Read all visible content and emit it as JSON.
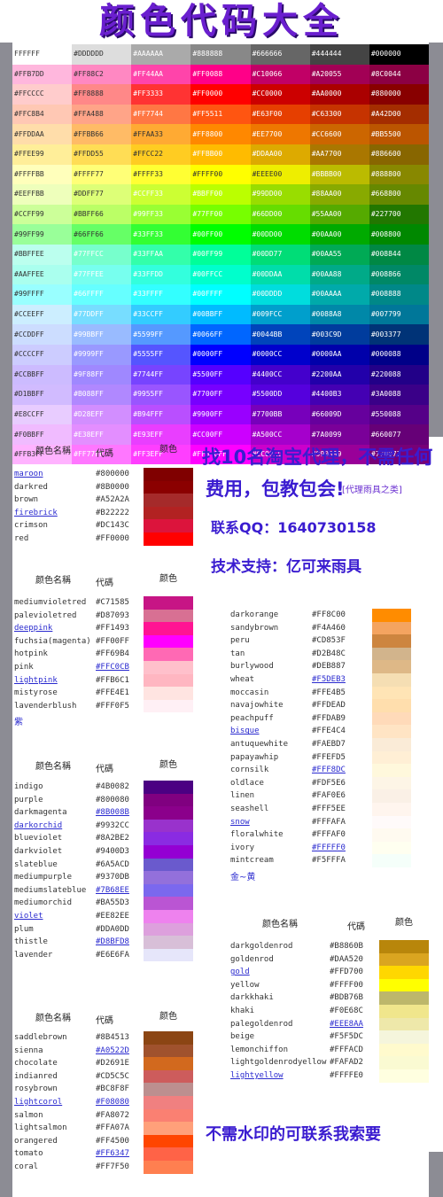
{
  "title": "颜色代码大全",
  "grid": [
    [
      [
        "FFFFFF",
        "#FFFFFF",
        "#333"
      ],
      [
        "#DDDDDD",
        "#DDDDDD",
        "#333"
      ],
      [
        "#AAAAAA",
        "#AAAAAA",
        "#fff"
      ],
      [
        "#888888",
        "#888888",
        "#fff"
      ],
      [
        "#666666",
        "#666666",
        "#fff"
      ],
      [
        "#444444",
        "#444444",
        "#fff"
      ],
      [
        "#000000",
        "#000000",
        "#fff"
      ]
    ],
    [
      [
        "#FFB7DD",
        "#FFB7DD",
        "#333"
      ],
      [
        "#FF88C2",
        "#FF88C2",
        "#333"
      ],
      [
        "#FF44AA",
        "#FF44AA",
        "#fff"
      ],
      [
        "#FF0088",
        "#FF0088",
        "#fff"
      ],
      [
        "#C10066",
        "#C10066",
        "#fff"
      ],
      [
        "#A20055",
        "#A20055",
        "#fff"
      ],
      [
        "#8C0044",
        "#8C0044",
        "#fff"
      ]
    ],
    [
      [
        "#FFCCCC",
        "#FFCCCC",
        "#333"
      ],
      [
        "#FF8888",
        "#FF8888",
        "#333"
      ],
      [
        "#FF3333",
        "#FF3333",
        "#fff"
      ],
      [
        "#FF0000",
        "#FF0000",
        "#fff"
      ],
      [
        "#CC0000",
        "#CC0000",
        "#fff"
      ],
      [
        "#AA0000",
        "#AA0000",
        "#fff"
      ],
      [
        "#880000",
        "#880000",
        "#fff"
      ]
    ],
    [
      [
        "#FFC8B4",
        "#FFC8B4",
        "#333"
      ],
      [
        "#FFA488",
        "#FFA488",
        "#333"
      ],
      [
        "#FF7744",
        "#FF7744",
        "#fff"
      ],
      [
        "#FF5511",
        "#FF5511",
        "#fff"
      ],
      [
        "#E63F00",
        "#E63F00",
        "#fff"
      ],
      [
        "#C63300",
        "#C63300",
        "#fff"
      ],
      [
        "#A42D00",
        "#A42D00",
        "#fff"
      ]
    ],
    [
      [
        "#FFDDAA",
        "#FFDDAA",
        "#333"
      ],
      [
        "#FFBB66",
        "#FFBB66",
        "#333"
      ],
      [
        "#FFAA33",
        "#FFAA33",
        "#333"
      ],
      [
        "#FF8800",
        "#FF8800",
        "#fff"
      ],
      [
        "#EE7700",
        "#EE7700",
        "#fff"
      ],
      [
        "#CC6600",
        "#CC6600",
        "#fff"
      ],
      [
        "#BB5500",
        "#BB5500",
        "#fff"
      ]
    ],
    [
      [
        "#FFEE99",
        "#FFEE99",
        "#333"
      ],
      [
        "#FFDD55",
        "#FFDD55",
        "#333"
      ],
      [
        "#FFCC22",
        "#FFCC22",
        "#333"
      ],
      [
        "#FFBB00",
        "#FFBB00",
        "#fff"
      ],
      [
        "#DDAA00",
        "#DDAA00",
        "#fff"
      ],
      [
        "#AA7700",
        "#AA7700",
        "#fff"
      ],
      [
        "#886600",
        "#886600",
        "#fff"
      ]
    ],
    [
      [
        "#FFFFBB",
        "#FFFFBB",
        "#333"
      ],
      [
        "#FFFF77",
        "#FFFF77",
        "#333"
      ],
      [
        "#FFFF33",
        "#FFFF33",
        "#333"
      ],
      [
        "#FFFF00",
        "#FFFF00",
        "#333"
      ],
      [
        "#EEEE00",
        "#EEEE00",
        "#333"
      ],
      [
        "#BBBB00",
        "#BBBB00",
        "#fff"
      ],
      [
        "#888800",
        "#888800",
        "#fff"
      ]
    ],
    [
      [
        "#EEFFBB",
        "#EEFFBB",
        "#333"
      ],
      [
        "#DDFF77",
        "#DDFF77",
        "#333"
      ],
      [
        "#CCFF33",
        "#CCFF33",
        "#fff"
      ],
      [
        "#BBFF00",
        "#BBFF00",
        "#fff"
      ],
      [
        "#99DD00",
        "#99DD00",
        "#fff"
      ],
      [
        "#88AA00",
        "#88AA00",
        "#fff"
      ],
      [
        "#668800",
        "#668800",
        "#fff"
      ]
    ],
    [
      [
        "#CCFF99",
        "#CCFF99",
        "#333"
      ],
      [
        "#BBFF66",
        "#BBFF66",
        "#333"
      ],
      [
        "#99FF33",
        "#99FF33",
        "#fff"
      ],
      [
        "#77FF00",
        "#77FF00",
        "#fff"
      ],
      [
        "#66DD00",
        "#66DD00",
        "#fff"
      ],
      [
        "#55AA00",
        "#55AA00",
        "#fff"
      ],
      [
        "#227700",
        "#227700",
        "#fff"
      ]
    ],
    [
      [
        "#99FF99",
        "#99FF99",
        "#333"
      ],
      [
        "#66FF66",
        "#66FF66",
        "#333"
      ],
      [
        "#33FF33",
        "#33FF33",
        "#fff"
      ],
      [
        "#00FF00",
        "#00FF00",
        "#fff"
      ],
      [
        "#00DD00",
        "#00DD00",
        "#fff"
      ],
      [
        "#00AA00",
        "#00AA00",
        "#fff"
      ],
      [
        "#008800",
        "#008800",
        "#fff"
      ]
    ],
    [
      [
        "#BBFFEE",
        "#BBFFEE",
        "#333"
      ],
      [
        "#77FFCC",
        "#77FFCC",
        "#fff"
      ],
      [
        "#33FFAA",
        "#33FFAA",
        "#fff"
      ],
      [
        "#00FF99",
        "#00FF99",
        "#fff"
      ],
      [
        "#00DD77",
        "#00DD77",
        "#fff"
      ],
      [
        "#00AA55",
        "#00AA55",
        "#fff"
      ],
      [
        "#008844",
        "#008844",
        "#fff"
      ]
    ],
    [
      [
        "#AAFFEE",
        "#AAFFEE",
        "#333"
      ],
      [
        "#77FFEE",
        "#77FFEE",
        "#fff"
      ],
      [
        "#33FFDD",
        "#33FFDD",
        "#fff"
      ],
      [
        "#00FFCC",
        "#00FFCC",
        "#fff"
      ],
      [
        "#00DDAA",
        "#00DDAA",
        "#fff"
      ],
      [
        "#00AA88",
        "#00AA88",
        "#fff"
      ],
      [
        "#008866",
        "#008866",
        "#fff"
      ]
    ],
    [
      [
        "#99FFFF",
        "#99FFFF",
        "#333"
      ],
      [
        "#66FFFF",
        "#66FFFF",
        "#fff"
      ],
      [
        "#33FFFF",
        "#33FFFF",
        "#fff"
      ],
      [
        "#00FFFF",
        "#00FFFF",
        "#fff"
      ],
      [
        "#00DDDD",
        "#00DDDD",
        "#fff"
      ],
      [
        "#00AAAA",
        "#00AAAA",
        "#fff"
      ],
      [
        "#008888",
        "#008888",
        "#fff"
      ]
    ],
    [
      [
        "#CCEEFF",
        "#CCEEFF",
        "#333"
      ],
      [
        "#77DDFF",
        "#77DDFF",
        "#fff"
      ],
      [
        "#33CCFF",
        "#33CCFF",
        "#fff"
      ],
      [
        "#00BBFF",
        "#00BBFF",
        "#fff"
      ],
      [
        "#009FCC",
        "#009FCC",
        "#fff"
      ],
      [
        "#0088A8",
        "#0088A8",
        "#fff"
      ],
      [
        "#007799",
        "#007799",
        "#fff"
      ]
    ],
    [
      [
        "#CCDDFF",
        "#CCDDFF",
        "#333"
      ],
      [
        "#99BBFF",
        "#99BBFF",
        "#fff"
      ],
      [
        "#5599FF",
        "#5599FF",
        "#fff"
      ],
      [
        "#0066FF",
        "#0066FF",
        "#fff"
      ],
      [
        "#0044BB",
        "#0044BB",
        "#fff"
      ],
      [
        "#003C9D",
        "#003C9D",
        "#fff"
      ],
      [
        "#003377",
        "#003377",
        "#fff"
      ]
    ],
    [
      [
        "#CCCCFF",
        "#CCCCFF",
        "#333"
      ],
      [
        "#9999FF",
        "#9999FF",
        "#fff"
      ],
      [
        "#5555FF",
        "#5555FF",
        "#fff"
      ],
      [
        "#0000FF",
        "#0000FF",
        "#fff"
      ],
      [
        "#0000CC",
        "#0000CC",
        "#fff"
      ],
      [
        "#0000AA",
        "#0000AA",
        "#fff"
      ],
      [
        "#000088",
        "#000088",
        "#fff"
      ]
    ],
    [
      [
        "#CCBBFF",
        "#CCBBFF",
        "#333"
      ],
      [
        "#9F88FF",
        "#9F88FF",
        "#fff"
      ],
      [
        "#7744FF",
        "#7744FF",
        "#fff"
      ],
      [
        "#5500FF",
        "#5500FF",
        "#fff"
      ],
      [
        "#4400CC",
        "#4400CC",
        "#fff"
      ],
      [
        "#2200AA",
        "#2200AA",
        "#fff"
      ],
      [
        "#220088",
        "#220088",
        "#fff"
      ]
    ],
    [
      [
        "#D1BBFF",
        "#D1BBFF",
        "#333"
      ],
      [
        "#B088FF",
        "#B088FF",
        "#fff"
      ],
      [
        "#9955FF",
        "#9955FF",
        "#fff"
      ],
      [
        "#7700FF",
        "#7700FF",
        "#fff"
      ],
      [
        "#5500DD",
        "#5500DD",
        "#fff"
      ],
      [
        "#4400B3",
        "#4400B3",
        "#fff"
      ],
      [
        "#3A0088",
        "#3A0088",
        "#fff"
      ]
    ],
    [
      [
        "#E8CCFF",
        "#E8CCFF",
        "#333"
      ],
      [
        "#D28EFF",
        "#D28EFF",
        "#fff"
      ],
      [
        "#B94FFF",
        "#B94FFF",
        "#fff"
      ],
      [
        "#9900FF",
        "#9900FF",
        "#fff"
      ],
      [
        "#7700BB",
        "#7700BB",
        "#fff"
      ],
      [
        "#66009D",
        "#66009D",
        "#fff"
      ],
      [
        "#550088",
        "#550088",
        "#fff"
      ]
    ],
    [
      [
        "#F0BBFF",
        "#F0BBFF",
        "#333"
      ],
      [
        "#E38EFF",
        "#E38EFF",
        "#fff"
      ],
      [
        "#E93EFF",
        "#E93EFF",
        "#fff"
      ],
      [
        "#CC00FF",
        "#CC00FF",
        "#fff"
      ],
      [
        "#A500CC",
        "#A500CC",
        "#fff"
      ],
      [
        "#7A0099",
        "#7A0099",
        "#fff"
      ],
      [
        "#660077",
        "#660077",
        "#fff"
      ]
    ],
    [
      [
        "#FFB3FF",
        "#FFB3FF",
        "#333"
      ],
      [
        "#FF77FF",
        "#FF77FF",
        "#fff"
      ],
      [
        "#FF3EFF",
        "#FF3EFF",
        "#fff"
      ],
      [
        "#FF0 0FF",
        "#FF00FF",
        "#fff"
      ],
      [
        "#CC00CC",
        "#CC00CC",
        "#fff"
      ],
      [
        "#990099",
        "#990099",
        "#fff"
      ],
      [
        "#770077",
        "#770077",
        "#fff"
      ]
    ]
  ],
  "headers": {
    "name": "颜色名稱",
    "code": "代碼",
    "color": "颜色"
  },
  "panels": [
    {
      "rows": [
        [
          "maroon",
          "#800000",
          "#800000",
          1
        ],
        [
          "darkred",
          "#8B0000",
          "#8B0000",
          0
        ],
        [
          "brown",
          "#A52A2A",
          "#A52A2A",
          0
        ],
        [
          "firebrick",
          "#B22222",
          "#B22222",
          1
        ],
        [
          "crimson",
          "#DC143C",
          "#DC143C",
          0
        ],
        [
          "red",
          "#FF0000",
          "#FF0000",
          0
        ]
      ]
    },
    {
      "rows": [
        [
          "mediumvioletred",
          "#C71585",
          "#C71585",
          0
        ],
        [
          "palevioletred",
          "#D87093",
          "#D87093",
          0
        ],
        [
          "deeppink",
          "#FF1493",
          "#FF1493",
          1
        ],
        [
          "fuchsia(magenta)",
          "#FF00FF",
          "#FF00FF",
          0
        ],
        [
          "hotpink",
          "#FF69B4",
          "#FF69B4",
          0
        ],
        [
          "pink",
          "#FFC0CB",
          "#FFC0CB",
          2
        ],
        [
          "lightpink",
          "#FFB6C1",
          "#FFB6C1",
          1
        ],
        [
          "mistyrose",
          "#FFE4E1",
          "#FFE4E1",
          0
        ],
        [
          "lavenderblush",
          "#FFF0F5",
          "#FFF0F5",
          0
        ]
      ],
      "foot": "紫"
    },
    {
      "rows": [
        [
          "indigo",
          "#4B0082",
          "#4B0082",
          0
        ],
        [
          "purple",
          "#800080",
          "#800080",
          0
        ],
        [
          "darkmagenta",
          "#8B008B",
          "#8B008B",
          2
        ],
        [
          "darkorchid",
          "#9932CC",
          "#9932CC",
          1
        ],
        [
          "blueviolet",
          "#8A2BE2",
          "#8A2BE2",
          0
        ],
        [
          "darkviolet",
          "#9400D3",
          "#9400D3",
          0
        ],
        [
          "slateblue",
          "#6A5ACD",
          "#6A5ACD",
          0
        ],
        [
          "mediumpurple",
          "#9370DB",
          "#9370DB",
          0
        ],
        [
          "mediumslateblue",
          "#7B68EE",
          "#7B68EE",
          2
        ],
        [
          "mediumorchid",
          "#BA55D3",
          "#BA55D3",
          0
        ],
        [
          "violet",
          "#EE82EE",
          "#EE82EE",
          1
        ],
        [
          "plum",
          "#DDA0DD",
          "#DDA0DD",
          0
        ],
        [
          "thistle",
          "#D8BFD8",
          "#D8BFD8",
          2
        ],
        [
          "lavender",
          "#E6E6FA",
          "#E6E6FA",
          0
        ]
      ]
    },
    {
      "rows": [
        [
          "saddlebrown",
          "#8B4513",
          "#8B4513",
          0
        ],
        [
          "sienna",
          "#A0522D",
          "#A0522D",
          2
        ],
        [
          "chocolate",
          "#D2691E",
          "#D2691E",
          0
        ],
        [
          "indianred",
          "#CD5C5C",
          "#CD5C5C",
          0
        ],
        [
          "rosybrown",
          "#BC8F8F",
          "#BC8F8F",
          0
        ],
        [
          "lightcorol",
          "#F08080",
          "#F08080",
          3
        ],
        [
          "salmon",
          "#FA8072",
          "#FA8072",
          0
        ],
        [
          "lightsalmon",
          "#FFA07A",
          "#FFA07A",
          0
        ],
        [
          "orangered",
          "#FF4500",
          "#FF4500",
          0
        ],
        [
          "tomato",
          "#FF6347",
          "#FF6347",
          2
        ],
        [
          "coral",
          "#FF7F50",
          "#FF7F50",
          0
        ]
      ]
    },
    {
      "rows": [
        [
          "darkorange",
          "#FF8C00",
          "#FF8C00",
          0
        ],
        [
          "sandybrown",
          "#F4A460",
          "#F4A460",
          0
        ],
        [
          "peru",
          "#CD853F",
          "#CD853F",
          0
        ],
        [
          "tan",
          "#D2B48C",
          "#D2B48C",
          0
        ],
        [
          "burlywood",
          "#DEB887",
          "#DEB887",
          0
        ],
        [
          "wheat",
          "#F5DEB3",
          "#F5DEB3",
          2
        ],
        [
          "moccasin",
          "#FFE4B5",
          "#FFE4B5",
          0
        ],
        [
          "navajowhite",
          "#FFDEAD",
          "#FFDEAD",
          0
        ],
        [
          "peachpuff",
          "#FFDAB9",
          "#FFDAB9",
          0
        ],
        [
          "bisque",
          "#FFE4C4",
          "#FFE4C4",
          1
        ],
        [
          "antuquewhite",
          "#FAEBD7",
          "#FAEBD7",
          0
        ],
        [
          "papayawhip",
          "#FFEFD5",
          "#FFEFD5",
          0
        ],
        [
          "cornsilk",
          "#FFF8DC",
          "#FFF8DC",
          2
        ],
        [
          "oldlace",
          "#FDF5E6",
          "#FDF5E6",
          0
        ],
        [
          "linen",
          "#FAF0E6",
          "#FAF0E6",
          0
        ],
        [
          "seashell",
          "#FFF5EE",
          "#FFF5EE",
          0
        ],
        [
          "snow",
          "#FFFAFA",
          "#FFFAFA",
          1
        ],
        [
          "floralwhite",
          "#FFFAF0",
          "#FFFAF0",
          0
        ],
        [
          "ivory",
          "#FFFFF0",
          "#FFFFF0",
          2
        ],
        [
          "mintcream",
          "#F5FFFA",
          "#F5FFFA",
          0
        ]
      ],
      "foot": "金~黄"
    },
    {
      "rows": [
        [
          "darkgoldenrod",
          "#B8860B",
          "#B8860B",
          0
        ],
        [
          "goldenrod",
          "#DAA520",
          "#DAA520",
          0
        ],
        [
          "gold",
          "#FFD700",
          "#FFD700",
          1
        ],
        [
          "yellow",
          "#FFFF00",
          "#FFFF00",
          0
        ],
        [
          "darkkhaki",
          "#BDB76B",
          "#BDB76B",
          0
        ],
        [
          "khaki",
          "#F0E68C",
          "#F0E68C",
          0
        ],
        [
          "palegoldenrod",
          "#EEE8AA",
          "#EEE8AA",
          2
        ],
        [
          "beige",
          "#F5F5DC",
          "#F5F5DC",
          0
        ],
        [
          "lemonchiffon",
          "#FFFACD",
          "#FFFACD",
          0
        ],
        [
          "lightgoldenrodyellow",
          "#FAFAD2",
          "#FAFAD2",
          0
        ],
        [
          "lightyellow",
          "#FFFFE0",
          "#FFFFE0",
          1
        ]
      ]
    }
  ],
  "promo": {
    "line1": "找10名淘宝代理，不需任何",
    "line2": "费用，包教包会!",
    "line2b": "[代理雨具之类]",
    "line3": "联系QQ：1640730158",
    "line4": "技术支持：亿可来雨具",
    "bottom": "不需水印的可联系我索要"
  }
}
